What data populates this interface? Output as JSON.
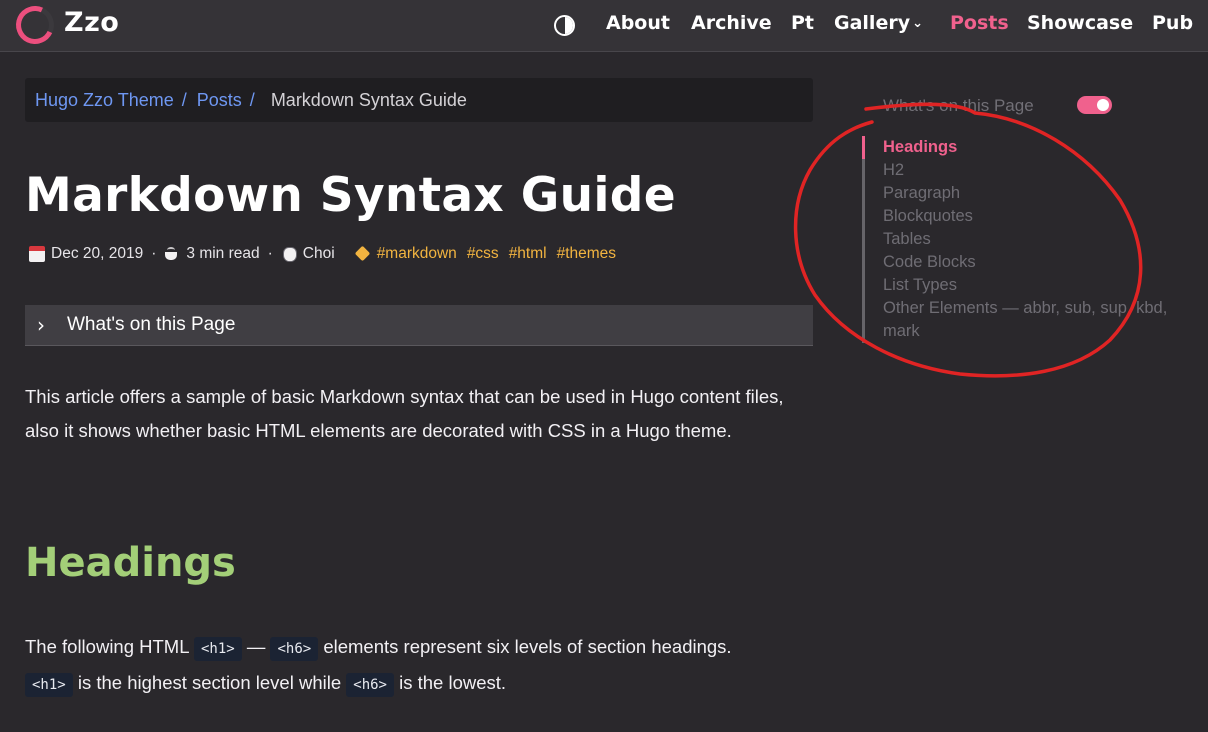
{
  "navbar": {
    "brand": "Zzo",
    "items": [
      {
        "label": "About",
        "active": false
      },
      {
        "label": "Archive",
        "active": false
      },
      {
        "label": "Pt",
        "active": false
      },
      {
        "label": "Gallery",
        "active": false,
        "dropdown": true
      },
      {
        "label": "Posts",
        "active": true
      },
      {
        "label": "Showcase",
        "active": false
      },
      {
        "label": "Pub",
        "active": false
      }
    ],
    "dropdown_glyph": "⌄",
    "theme_toggle_icon": "contrast-icon"
  },
  "breadcrumb": {
    "items": [
      "Hugo Zzo Theme",
      "Posts"
    ],
    "separator": "/",
    "current": "Markdown Syntax Guide"
  },
  "post": {
    "title": "Markdown Syntax Guide",
    "meta": {
      "date": "Dec 20, 2019",
      "read_time": "3 min read",
      "author": "Choi",
      "separator": "·",
      "tags": [
        "#markdown",
        "#css",
        "#html",
        "#themes"
      ]
    },
    "toc_toggle": {
      "label": "What's on this Page",
      "icon": "chevron-right-icon",
      "glyph": "›"
    },
    "intro": "This article offers a sample of basic Markdown syntax that can be used in Hugo content files, also it shows whether basic HTML elements are decorated with CSS in a Hugo theme.",
    "section_heading": "Headings",
    "headings_text": {
      "part1": "The following HTML",
      "code_h1": "<h1>",
      "dash": "—",
      "code_h6": "<h6>",
      "part2": "elements represent six levels of section headings.",
      "part3": "is the highest section level while",
      "part4": "is the lowest."
    }
  },
  "sidebar_toc": {
    "title": "What's on this Page",
    "toggle_on": true,
    "items": [
      {
        "label": "Headings",
        "active": true
      },
      {
        "label": "H2",
        "active": false
      },
      {
        "label": "Paragraph",
        "active": false
      },
      {
        "label": "Blockquotes",
        "active": false
      },
      {
        "label": "Tables",
        "active": false
      },
      {
        "label": "Code Blocks",
        "active": false
      },
      {
        "label": "List Types",
        "active": false
      },
      {
        "label": "Other Elements — abbr, sub, sup, kbd, mark",
        "active": false
      }
    ]
  },
  "colors": {
    "background": "#2a282c",
    "navbar": "#353337",
    "accent_pink": "#f0618d",
    "link_blue": "#6e97f2",
    "tag_yellow": "#f2b440",
    "heading_green": "#a3cf78",
    "annotation_red": "#e02424"
  }
}
